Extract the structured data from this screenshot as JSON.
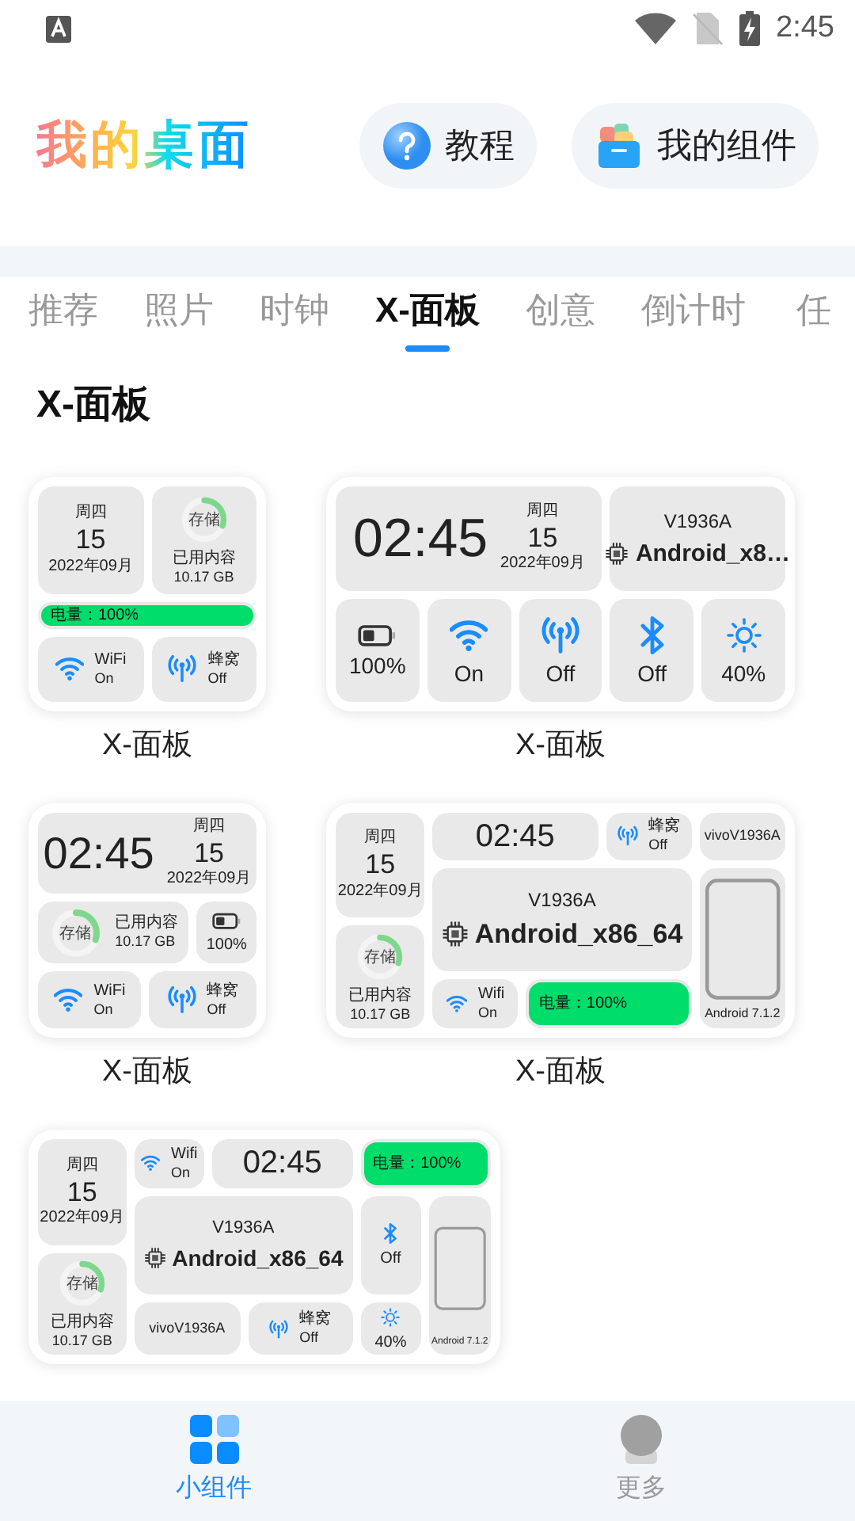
{
  "status_bar": {
    "time": "2:45"
  },
  "header": {
    "logo": "我的桌面",
    "buttons": [
      {
        "kind": "help",
        "label": "教程"
      },
      {
        "kind": "box",
        "label": "我的组件"
      }
    ]
  },
  "tabs": [
    {
      "label": "推荐",
      "selected": false
    },
    {
      "label": "照片",
      "selected": false
    },
    {
      "label": "时钟",
      "selected": false
    },
    {
      "label": "X-面板",
      "selected": true
    },
    {
      "label": "创意",
      "selected": false
    },
    {
      "label": "倒计时",
      "selected": false
    },
    {
      "label": "任",
      "selected": false
    }
  ],
  "section_title": "X-面板",
  "widgets": [
    {
      "kind": "small",
      "caption": "X-面板",
      "tiles": [
        {
          "kind": "date",
          "weekday": "周四",
          "day": "15",
          "month": "2022年09月"
        },
        {
          "kind": "storage",
          "ring_label": "存储",
          "used_label": "已用内容",
          "used_value": "10.17 GB",
          "level": 0.3
        },
        {
          "kind": "battery_bar",
          "text": "电量：100%",
          "level": 1
        },
        {
          "kind": "wifi",
          "label": "WiFi",
          "value": "On"
        },
        {
          "kind": "cellular",
          "label": "蜂窝",
          "value": "Off"
        }
      ]
    },
    {
      "kind": "wide",
      "caption": "X-面板",
      "tiles": [
        {
          "kind": "clock",
          "time": "02:45",
          "weekday": "周四",
          "day": "15",
          "month": "2022年09月"
        },
        {
          "kind": "device",
          "model": "V1936A",
          "name": "Android_x8…"
        },
        {
          "kind": "battery",
          "value": "100%"
        },
        {
          "kind": "wifi",
          "value": "On"
        },
        {
          "kind": "cellular",
          "value": "Off"
        },
        {
          "kind": "bluetooth",
          "value": "Off"
        },
        {
          "kind": "brightness",
          "value": "40%"
        }
      ]
    },
    {
      "kind": "small2",
      "caption": "X-面板",
      "tiles": [
        {
          "kind": "clock",
          "time": "02:45",
          "weekday": "周四",
          "day": "15",
          "month": "2022年09月"
        },
        {
          "kind": "storage",
          "ring_label": "存储",
          "used_label": "已用内容",
          "used_value": "10.17 GB",
          "level": 0.3
        },
        {
          "kind": "battery",
          "value": "100%"
        },
        {
          "kind": "wifi",
          "label": "WiFi",
          "value": "On"
        },
        {
          "kind": "cellular",
          "label": "蜂窝",
          "value": "Off"
        }
      ]
    },
    {
      "kind": "wide2",
      "caption": "X-面板",
      "tiles": [
        {
          "kind": "date",
          "weekday": "周四",
          "day": "15",
          "month": "2022年09月"
        },
        {
          "kind": "storage",
          "ring_label": "存储",
          "used_label": "已用内容",
          "used_value": "10.17 GB",
          "level": 0.3
        },
        {
          "kind": "clock",
          "time": "02:45"
        },
        {
          "kind": "cellular",
          "label": "蜂窝",
          "value": "Off"
        },
        {
          "kind": "text",
          "text": "vivoV1936A"
        },
        {
          "kind": "device",
          "model": "V1936A",
          "name": "Android_x86_64"
        },
        {
          "kind": "wifi",
          "label": "Wifi",
          "value": "On"
        },
        {
          "kind": "battery_bar",
          "text": "电量：100%",
          "level": 1
        },
        {
          "kind": "phone",
          "version": "Android 7.1.2"
        }
      ]
    },
    {
      "kind": "large",
      "tiles": [
        {
          "kind": "date",
          "weekday": "周四",
          "day": "15",
          "month": "2022年09月"
        },
        {
          "kind": "storage",
          "ring_label": "存储",
          "used_label": "已用内容",
          "used_value": "10.17 GB",
          "level": 0.3
        },
        {
          "kind": "wifi",
          "label": "Wifi",
          "value": "On"
        },
        {
          "kind": "clock",
          "time": "02:45"
        },
        {
          "kind": "battery_bar",
          "text": "电量：100%",
          "level": 1
        },
        {
          "kind": "device",
          "model": "V1936A",
          "name": "Android_x86_64"
        },
        {
          "kind": "bluetooth",
          "value": "Off"
        },
        {
          "kind": "brightness",
          "value": "40%"
        },
        {
          "kind": "phone",
          "version": "Android 7.1.2"
        },
        {
          "kind": "text",
          "text": "vivoV1936A"
        },
        {
          "kind": "cellular",
          "label": "蜂窝",
          "value": "Off"
        }
      ]
    }
  ],
  "bottom_nav": [
    {
      "kind": "widgets",
      "label": "小组件",
      "selected": true
    },
    {
      "kind": "profile",
      "label": "更多",
      "selected": false
    }
  ]
}
